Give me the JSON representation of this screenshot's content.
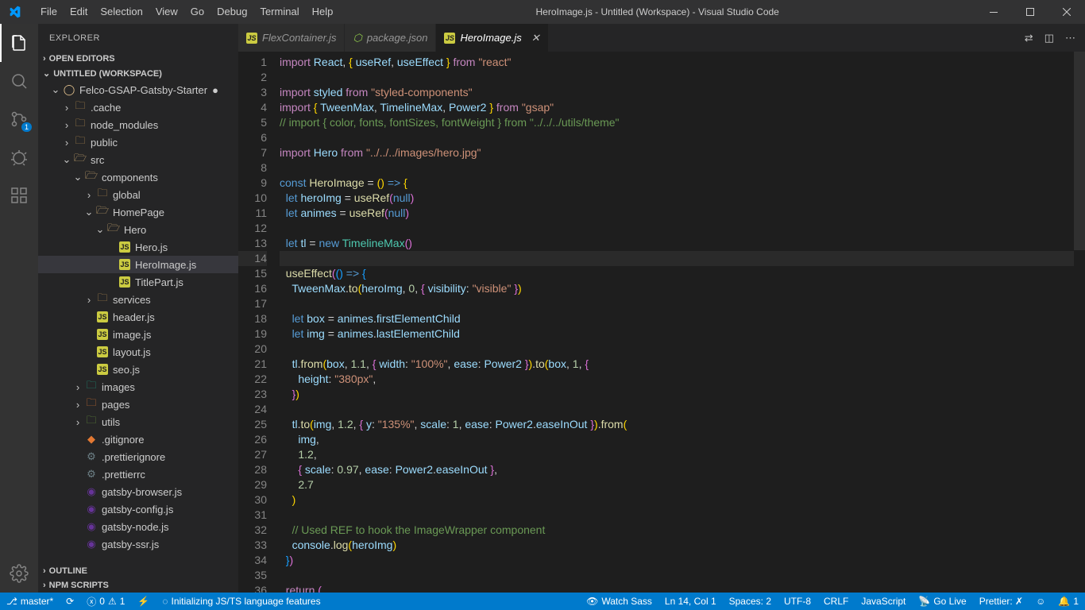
{
  "window": {
    "title": "HeroImage.js - Untitled (Workspace) - Visual Studio Code"
  },
  "menu": [
    "File",
    "Edit",
    "Selection",
    "View",
    "Go",
    "Debug",
    "Terminal",
    "Help"
  ],
  "activitybar": {
    "scm_badge": "1"
  },
  "explorer": {
    "title": "EXPLORER",
    "open_editors": "OPEN EDITORS",
    "workspace": "UNTITLED (WORKSPACE)",
    "outline": "OUTLINE",
    "npm_scripts": "NPM SCRIPTS",
    "tree": {
      "project": "Felco-GSAP-Gatsby-Starter",
      "cache": ".cache",
      "node_modules": "node_modules",
      "public": "public",
      "src": "src",
      "components": "components",
      "global": "global",
      "homepage": "HomePage",
      "hero": "Hero",
      "hero_js": "Hero.js",
      "heroimage_js": "HeroImage.js",
      "titlepart_js": "TitlePart.js",
      "services": "services",
      "header_js": "header.js",
      "image_js": "image.js",
      "layout_js": "layout.js",
      "seo_js": "seo.js",
      "images": "images",
      "pages": "pages",
      "utils": "utils",
      "gitignore": ".gitignore",
      "prettierignore": ".prettierignore",
      "prettierrc": ".prettierrc",
      "gatsby_browser": "gatsby-browser.js",
      "gatsby_config": "gatsby-config.js",
      "gatsby_node": "gatsby-node.js",
      "gatsby_ssr": "gatsby-ssr.js"
    }
  },
  "tabs": {
    "flex": "FlexContainer.js",
    "package": "package.json",
    "hero": "HeroImage.js"
  },
  "statusbar": {
    "branch": "master*",
    "errors": "0",
    "warnings": "1",
    "init": "Initializing JS/TS language features",
    "watch": "Watch Sass",
    "cursor": "Ln 14, Col 1",
    "spaces": "Spaces: 2",
    "encoding": "UTF-8",
    "eol": "CRLF",
    "lang": "JavaScript",
    "golive": "Go Live",
    "prettier": "Prettier: ✗",
    "feedback": "☺",
    "bell": "1"
  },
  "code_lines": [
    "1",
    "2",
    "3",
    "4",
    "5",
    "6",
    "7",
    "8",
    "9",
    "10",
    "11",
    "12",
    "13",
    "14",
    "15",
    "16",
    "17",
    "18",
    "19",
    "20",
    "21",
    "22",
    "23",
    "24",
    "25",
    "26",
    "27",
    "28",
    "29",
    "30",
    "31",
    "32",
    "33",
    "34",
    "35",
    "36"
  ]
}
